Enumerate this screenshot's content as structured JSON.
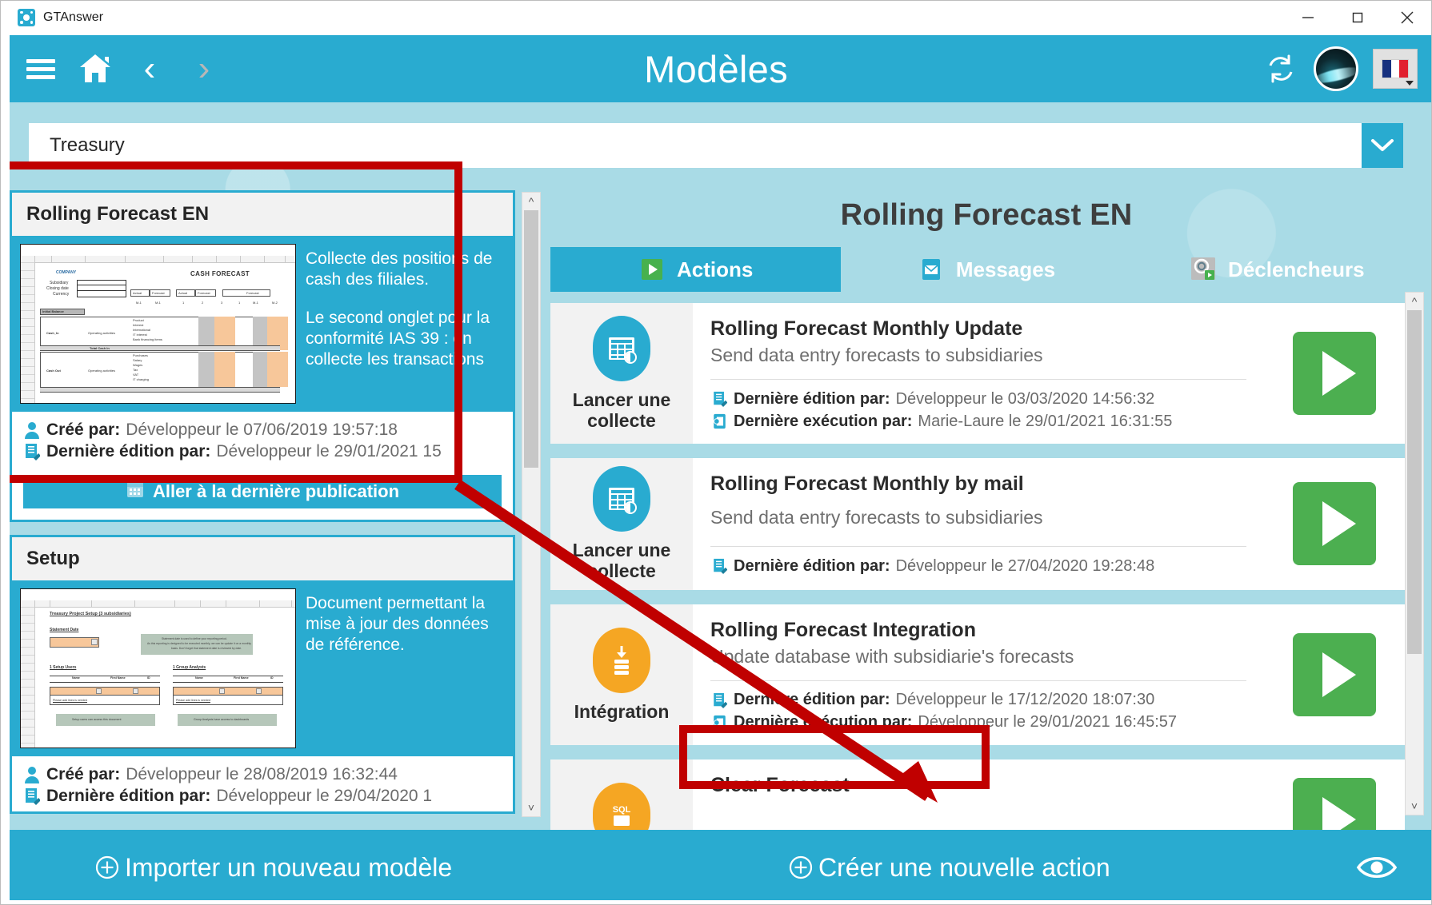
{
  "window": {
    "app_title": "GTAnswer",
    "logo_icon": "gt-logo-icon",
    "minimize_icon": "minimize-icon",
    "maximize_icon": "maximize-icon",
    "close_icon": "close-icon"
  },
  "header": {
    "title": "Modèles",
    "menu_icon": "hamburger-menu-icon",
    "home_icon": "home-icon",
    "back_icon": "chevron-left-icon",
    "forward_icon": "chevron-right-icon",
    "refresh_icon": "refresh-icon",
    "avatar_icon": "user-avatar",
    "language": "FR",
    "language_icon": "french-flag-icon",
    "language_caret_icon": "caret-down-icon"
  },
  "selector": {
    "value": "Treasury",
    "caret_icon": "chevron-down-icon"
  },
  "left_panel": {
    "scroll_up_icon": "chevron-up-icon",
    "scroll_down_icon": "chevron-down-icon",
    "cards": [
      {
        "title": "Rolling Forecast EN",
        "thumbnail_icon": "cash-forecast-spreadsheet-thumbnail",
        "thumbnail_label": "CASH FORECAST",
        "description_1": "Collecte des positions de cash des filiales.",
        "description_2": "Le second onglet pour la conformité IAS 39 : on collecte les transactions",
        "created_label": "Créé par:",
        "created_value": "Développeur le 07/06/2019 19:57:18",
        "created_icon": "user-icon",
        "edited_label": "Dernière édition par:",
        "edited_value": "Développeur le 29/01/2021 15",
        "edited_icon": "edit-document-icon",
        "action_label": "Aller à la dernière publication",
        "action_icon": "calendar-icon"
      },
      {
        "title": "Setup",
        "thumbnail_icon": "treasury-setup-spreadsheet-thumbnail",
        "thumbnail_label": "Treasury Project Setup (3 subsidiaries)",
        "description_1": "Document permettant la mise à jour des données de référence.",
        "description_2": "",
        "created_label": "Créé par:",
        "created_value": "Développeur le 28/08/2019 16:32:44",
        "created_icon": "user-icon",
        "edited_label": "Dernière édition par:",
        "edited_value": "Développeur le 29/04/2020 1",
        "edited_icon": "edit-document-icon",
        "action_label": "",
        "action_icon": ""
      }
    ]
  },
  "right_panel": {
    "title": "Rolling Forecast EN",
    "scroll_up_icon": "chevron-up-icon",
    "scroll_down_icon": "chevron-down-icon",
    "tabs": [
      {
        "label": "Actions",
        "icon": "play-green-icon",
        "active": true
      },
      {
        "label": "Messages",
        "icon": "envelope-icon",
        "active": false
      },
      {
        "label": "Déclencheurs",
        "icon": "trigger-gear-icon",
        "active": false
      }
    ],
    "actions": [
      {
        "type_label": "Lancer une collecte",
        "type_icon": "datasheet-collect-icon",
        "badge_color": "#29ABD0",
        "name": "Rolling Forecast Monthly Update",
        "subtitle": "Send data entry forecasts to subsidiaries",
        "edited_label": "Dernière édition par:",
        "edited_value": "Développeur le 03/03/2020 14:56:32",
        "edited_icon": "edit-document-icon",
        "executed_label": "Dernière exécution par:",
        "executed_value": "Marie-Laure le 29/01/2021 16:31:55",
        "executed_icon": "run-history-icon",
        "run_icon": "play-button-icon"
      },
      {
        "type_label": "Lancer une collecte",
        "type_icon": "datasheet-collect-icon",
        "badge_color": "#29ABD0",
        "name": "Rolling Forecast Monthly by mail",
        "subtitle": "Send data entry forecasts to subsidiaries",
        "edited_label": "Dernière édition par:",
        "edited_value": "Développeur le 27/04/2020 19:28:48",
        "edited_icon": "edit-document-icon",
        "executed_label": "",
        "executed_value": "",
        "executed_icon": "",
        "run_icon": "play-button-icon"
      },
      {
        "type_label": "Intégration",
        "type_icon": "database-import-icon",
        "badge_color": "#F5A623",
        "name": "Rolling Forecast Integration",
        "subtitle": "Update database with subsidiarie's forecasts",
        "edited_label": "Dernière édition par:",
        "edited_value": "Développeur le 17/12/2020 18:07:30",
        "edited_icon": "edit-document-icon",
        "executed_label": "Dernière exécution par:",
        "executed_value": "Développeur le 29/01/2021 16:45:57",
        "executed_icon": "run-history-icon",
        "run_icon": "play-button-icon"
      },
      {
        "type_label": "",
        "type_icon": "sql-icon",
        "badge_color": "#F5A623",
        "name": "Clear Forecast",
        "subtitle": "",
        "edited_label": "",
        "edited_value": "",
        "edited_icon": "",
        "executed_label": "",
        "executed_value": "",
        "executed_icon": "",
        "run_icon": "play-button-icon"
      }
    ]
  },
  "footer": {
    "import_label": "Importer un nouveau modèle",
    "import_icon": "plus-circle-icon",
    "create_action_label": "Créer une nouvelle action",
    "create_action_icon": "plus-circle-icon",
    "preview_icon": "eye-icon"
  },
  "annotations": {
    "color": "#C00000",
    "highlight_1": "rolling-forecast-en-card",
    "highlight_2": "creer-une-nouvelle-action-button",
    "arrow": "arrow-from-card-to-create-action"
  }
}
